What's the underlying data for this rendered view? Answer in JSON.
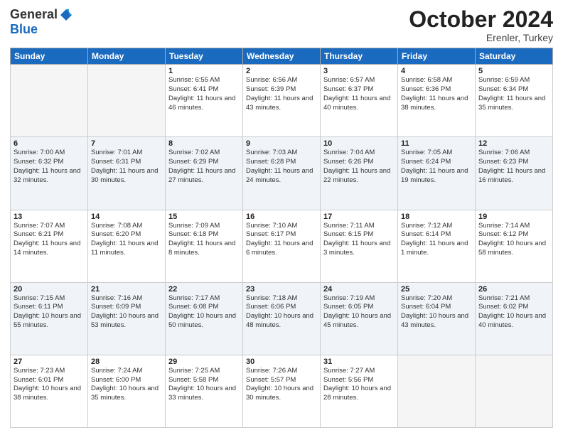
{
  "header": {
    "logo_general": "General",
    "logo_blue": "Blue",
    "month": "October 2024",
    "location": "Erenler, Turkey"
  },
  "days_of_week": [
    "Sunday",
    "Monday",
    "Tuesday",
    "Wednesday",
    "Thursday",
    "Friday",
    "Saturday"
  ],
  "weeks": [
    [
      {
        "day": "",
        "empty": true
      },
      {
        "day": "",
        "empty": true
      },
      {
        "day": "1",
        "sunrise": "Sunrise: 6:55 AM",
        "sunset": "Sunset: 6:41 PM",
        "daylight": "Daylight: 11 hours and 46 minutes."
      },
      {
        "day": "2",
        "sunrise": "Sunrise: 6:56 AM",
        "sunset": "Sunset: 6:39 PM",
        "daylight": "Daylight: 11 hours and 43 minutes."
      },
      {
        "day": "3",
        "sunrise": "Sunrise: 6:57 AM",
        "sunset": "Sunset: 6:37 PM",
        "daylight": "Daylight: 11 hours and 40 minutes."
      },
      {
        "day": "4",
        "sunrise": "Sunrise: 6:58 AM",
        "sunset": "Sunset: 6:36 PM",
        "daylight": "Daylight: 11 hours and 38 minutes."
      },
      {
        "day": "5",
        "sunrise": "Sunrise: 6:59 AM",
        "sunset": "Sunset: 6:34 PM",
        "daylight": "Daylight: 11 hours and 35 minutes."
      }
    ],
    [
      {
        "day": "6",
        "sunrise": "Sunrise: 7:00 AM",
        "sunset": "Sunset: 6:32 PM",
        "daylight": "Daylight: 11 hours and 32 minutes."
      },
      {
        "day": "7",
        "sunrise": "Sunrise: 7:01 AM",
        "sunset": "Sunset: 6:31 PM",
        "daylight": "Daylight: 11 hours and 30 minutes."
      },
      {
        "day": "8",
        "sunrise": "Sunrise: 7:02 AM",
        "sunset": "Sunset: 6:29 PM",
        "daylight": "Daylight: 11 hours and 27 minutes."
      },
      {
        "day": "9",
        "sunrise": "Sunrise: 7:03 AM",
        "sunset": "Sunset: 6:28 PM",
        "daylight": "Daylight: 11 hours and 24 minutes."
      },
      {
        "day": "10",
        "sunrise": "Sunrise: 7:04 AM",
        "sunset": "Sunset: 6:26 PM",
        "daylight": "Daylight: 11 hours and 22 minutes."
      },
      {
        "day": "11",
        "sunrise": "Sunrise: 7:05 AM",
        "sunset": "Sunset: 6:24 PM",
        "daylight": "Daylight: 11 hours and 19 minutes."
      },
      {
        "day": "12",
        "sunrise": "Sunrise: 7:06 AM",
        "sunset": "Sunset: 6:23 PM",
        "daylight": "Daylight: 11 hours and 16 minutes."
      }
    ],
    [
      {
        "day": "13",
        "sunrise": "Sunrise: 7:07 AM",
        "sunset": "Sunset: 6:21 PM",
        "daylight": "Daylight: 11 hours and 14 minutes."
      },
      {
        "day": "14",
        "sunrise": "Sunrise: 7:08 AM",
        "sunset": "Sunset: 6:20 PM",
        "daylight": "Daylight: 11 hours and 11 minutes."
      },
      {
        "day": "15",
        "sunrise": "Sunrise: 7:09 AM",
        "sunset": "Sunset: 6:18 PM",
        "daylight": "Daylight: 11 hours and 8 minutes."
      },
      {
        "day": "16",
        "sunrise": "Sunrise: 7:10 AM",
        "sunset": "Sunset: 6:17 PM",
        "daylight": "Daylight: 11 hours and 6 minutes."
      },
      {
        "day": "17",
        "sunrise": "Sunrise: 7:11 AM",
        "sunset": "Sunset: 6:15 PM",
        "daylight": "Daylight: 11 hours and 3 minutes."
      },
      {
        "day": "18",
        "sunrise": "Sunrise: 7:12 AM",
        "sunset": "Sunset: 6:14 PM",
        "daylight": "Daylight: 11 hours and 1 minute."
      },
      {
        "day": "19",
        "sunrise": "Sunrise: 7:14 AM",
        "sunset": "Sunset: 6:12 PM",
        "daylight": "Daylight: 10 hours and 58 minutes."
      }
    ],
    [
      {
        "day": "20",
        "sunrise": "Sunrise: 7:15 AM",
        "sunset": "Sunset: 6:11 PM",
        "daylight": "Daylight: 10 hours and 55 minutes."
      },
      {
        "day": "21",
        "sunrise": "Sunrise: 7:16 AM",
        "sunset": "Sunset: 6:09 PM",
        "daylight": "Daylight: 10 hours and 53 minutes."
      },
      {
        "day": "22",
        "sunrise": "Sunrise: 7:17 AM",
        "sunset": "Sunset: 6:08 PM",
        "daylight": "Daylight: 10 hours and 50 minutes."
      },
      {
        "day": "23",
        "sunrise": "Sunrise: 7:18 AM",
        "sunset": "Sunset: 6:06 PM",
        "daylight": "Daylight: 10 hours and 48 minutes."
      },
      {
        "day": "24",
        "sunrise": "Sunrise: 7:19 AM",
        "sunset": "Sunset: 6:05 PM",
        "daylight": "Daylight: 10 hours and 45 minutes."
      },
      {
        "day": "25",
        "sunrise": "Sunrise: 7:20 AM",
        "sunset": "Sunset: 6:04 PM",
        "daylight": "Daylight: 10 hours and 43 minutes."
      },
      {
        "day": "26",
        "sunrise": "Sunrise: 7:21 AM",
        "sunset": "Sunset: 6:02 PM",
        "daylight": "Daylight: 10 hours and 40 minutes."
      }
    ],
    [
      {
        "day": "27",
        "sunrise": "Sunrise: 7:23 AM",
        "sunset": "Sunset: 6:01 PM",
        "daylight": "Daylight: 10 hours and 38 minutes."
      },
      {
        "day": "28",
        "sunrise": "Sunrise: 7:24 AM",
        "sunset": "Sunset: 6:00 PM",
        "daylight": "Daylight: 10 hours and 35 minutes."
      },
      {
        "day": "29",
        "sunrise": "Sunrise: 7:25 AM",
        "sunset": "Sunset: 5:58 PM",
        "daylight": "Daylight: 10 hours and 33 minutes."
      },
      {
        "day": "30",
        "sunrise": "Sunrise: 7:26 AM",
        "sunset": "Sunset: 5:57 PM",
        "daylight": "Daylight: 10 hours and 30 minutes."
      },
      {
        "day": "31",
        "sunrise": "Sunrise: 7:27 AM",
        "sunset": "Sunset: 5:56 PM",
        "daylight": "Daylight: 10 hours and 28 minutes."
      },
      {
        "day": "",
        "empty": true
      },
      {
        "day": "",
        "empty": true
      }
    ]
  ]
}
